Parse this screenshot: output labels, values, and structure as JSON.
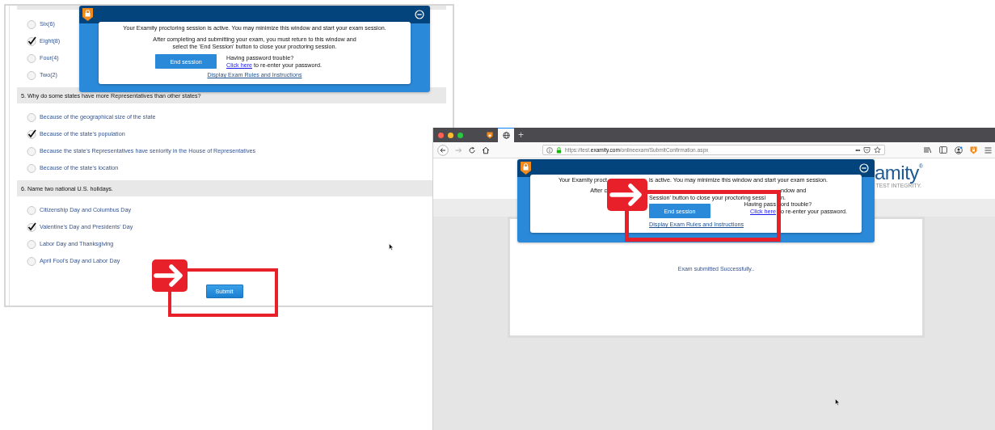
{
  "exam_window": {
    "options_top": [
      {
        "label": "Six(6)",
        "selected": false
      },
      {
        "label": "Eight(8)",
        "selected": true
      },
      {
        "label": "Four(4)",
        "selected": false
      },
      {
        "label": "Two(2)",
        "selected": false
      }
    ],
    "questions": [
      {
        "title": "5. Why do some states have more Representatives than other states?",
        "options": [
          {
            "label": "Because of the geographical size of the state",
            "selected": false
          },
          {
            "label": "Because of the state's population",
            "selected": true
          },
          {
            "label": "Because the state's Representatives have seniority in the House of Representatives",
            "selected": false
          },
          {
            "label": "Because of the state's location",
            "selected": false
          }
        ]
      },
      {
        "title": "6. Name two national U.S. holidays.",
        "options": [
          {
            "label": "Citizenship Day and Columbus Day",
            "selected": false
          },
          {
            "label": "Valentine's Day and Presidents' Day",
            "selected": true
          },
          {
            "label": "Labor Day and Thanksgiving",
            "selected": false
          },
          {
            "label": "April Fool's Day and Labor Day",
            "selected": false
          }
        ]
      }
    ],
    "submit_button": "Submit",
    "proctor_popup": {
      "lines": [
        [
          {
            "kind": "plain",
            "text": "Your Examity proctoring session is active. You may minimize this window and start your exam session."
          }
        ],
        [
          {
            "kind": "plain",
            "text": "After completing and submitting your exam, you must return to this window and"
          }
        ],
        [
          {
            "kind": "plain",
            "text": "select the 'End Session' button to close your proctoring session."
          }
        ]
      ],
      "end_button": "End session",
      "help_lines": [
        [
          {
            "kind": "plain",
            "text": "Having password trouble?"
          }
        ],
        [
          {
            "kind": "link",
            "text": "Click here"
          },
          {
            "kind": "plain",
            "text": "to re-enter your password."
          }
        ]
      ],
      "rules_link": "Display Exam Rules and Instructions"
    }
  },
  "browser_window": {
    "tabs": [
      {
        "selected": false
      },
      {
        "selected": true
      }
    ],
    "new_tab": "+",
    "url": "https://test.**examity.com**/onlineexam/SubmitConfirmation.aspx",
    "page_actions": "•••",
    "logo": {
      "text": "amity",
      "mark": "®",
      "tagline": "TEST INTEGRITY."
    },
    "message": "Exam submitted Successfully..",
    "proctor_popup": {
      "lines": [
        [
          {
            "kind": "plain",
            "text": "Your Examity proct"
          },
          {
            "kind": "plain",
            "text": "is active. You may minimize this window and start your exam session."
          }
        ],
        [
          {
            "kind": "plain",
            "text": "After c"
          },
          {
            "kind": "plain",
            "text": "ndow and"
          }
        ],
        [
          {
            "kind": "plain",
            "text": "Session' button to close your proctoring sessi"
          },
          {
            "kind": "plain",
            "text": "n."
          }
        ]
      ],
      "end_button": "End session",
      "help_lines": [
        [
          {
            "kind": "plain",
            "text": "Having pass"
          },
          {
            "kind": "plain",
            "text": "ord trouble?"
          }
        ],
        [
          {
            "kind": "link",
            "text": "Click here"
          },
          {
            "kind": "plain",
            "text": "o re-enter your password."
          }
        ]
      ],
      "rules_link": "Display Exam Rules and Instructions"
    }
  }
}
